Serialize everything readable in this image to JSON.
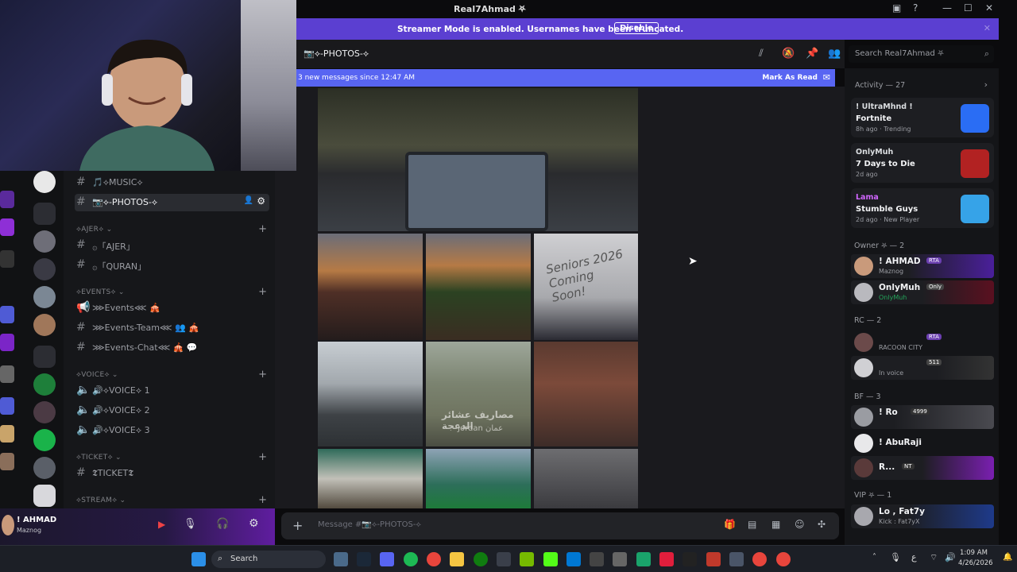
{
  "window": {
    "title": "Real7Ahmad ⛧"
  },
  "banner": {
    "message": "Streamer Mode is enabled. Usernames have been truncated.",
    "disable_label": "Disable"
  },
  "chat": {
    "channel_name": "📷⟡-PHOTOS-⟡",
    "new_messages": "3 new messages since 12:47 AM",
    "mark_as_read": "Mark As Read",
    "composer_placeholder": "Message #📷⟡-PHOTOS-⟡",
    "photo_text_1": "Seniors 2026 Coming Soon!",
    "photo_text_2": "مصاريف عشائر الدعجة",
    "photo_text_3": "Jordan عمان"
  },
  "search": {
    "placeholder": "Search Real7Ahmad ⛧"
  },
  "channels": {
    "top": [
      {
        "label": "🎵⟡MUSIC⟡"
      },
      {
        "label": "📷⟡-PHOTOS-⟡"
      }
    ],
    "categories": [
      {
        "name": "⟡AJER⟡ ⌄",
        "items": [
          "۞「AJER」",
          "۞「QURAN」"
        ]
      },
      {
        "name": "⟡EVENTS⟡ ⌄",
        "items": [
          "⋙Events⋘ 🎪",
          "⋙Events-Team⋘ 👥 🎪",
          "⋙Events-Chat⋘ 🎪 💬"
        ]
      },
      {
        "name": "⟡VOICE⟡ ⌄",
        "items": [
          "🔊⟡VOICE⟡ 1",
          "🔊⟡VOICE⟡ 2",
          "🔊⟡VOICE⟡ 3"
        ]
      },
      {
        "name": "⟡TICKET⟡ ⌄",
        "items": [
          "𝕿TICKET𝕿"
        ]
      },
      {
        "name": "⟡STREAM⟡ ⌄",
        "items": []
      }
    ]
  },
  "user": {
    "name": "! AHMAD",
    "tag": "Maznog"
  },
  "members": {
    "activity_header": "Activity — 27",
    "activities": [
      {
        "user": "! UltraMhnd !",
        "game": "Fortnite",
        "meta": "8h ago · Trending",
        "color": "#2a6df4"
      },
      {
        "user": "OnlyMuh",
        "game": "7 Days to Die",
        "meta": "2d ago",
        "color": "#b22222"
      },
      {
        "user": "Lama",
        "game": "Stumble Guys",
        "meta": "2d ago · New Player",
        "color": "#36a3e8"
      }
    ],
    "groups": [
      {
        "name": "Owner ⛧ — 2",
        "members": [
          {
            "name": "! AHMAD",
            "status": "Maznog",
            "badge": "RTA"
          },
          {
            "name": "OnlyMuh",
            "status": "OnlyMuh",
            "badge": "Only"
          }
        ]
      },
      {
        "name": "RC — 2",
        "members": [
          {
            "name": "",
            "status": "RACOON CITY",
            "badge": "RTA"
          },
          {
            "name": "",
            "status": "In voice",
            "badge": "511"
          }
        ]
      },
      {
        "name": "BF — 3",
        "members": [
          {
            "name": "! Ro",
            "status": "",
            "badge": "4999"
          },
          {
            "name": "! AbuRaji",
            "status": "",
            "badge": ""
          },
          {
            "name": "R...",
            "status": "",
            "badge": "NT"
          }
        ]
      },
      {
        "name": "VIP ⛧ — 1",
        "members": [
          {
            "name": "Lo , Fat7y",
            "status": "Kick : Fat7yX",
            "badge": ""
          }
        ]
      }
    ]
  },
  "taskbar": {
    "search_label": "Search",
    "time": "1:09 AM",
    "date": "4/26/2026",
    "lang": "ع"
  },
  "colors": {
    "accent": "#5865f2",
    "banner": "#5b3fd1"
  }
}
